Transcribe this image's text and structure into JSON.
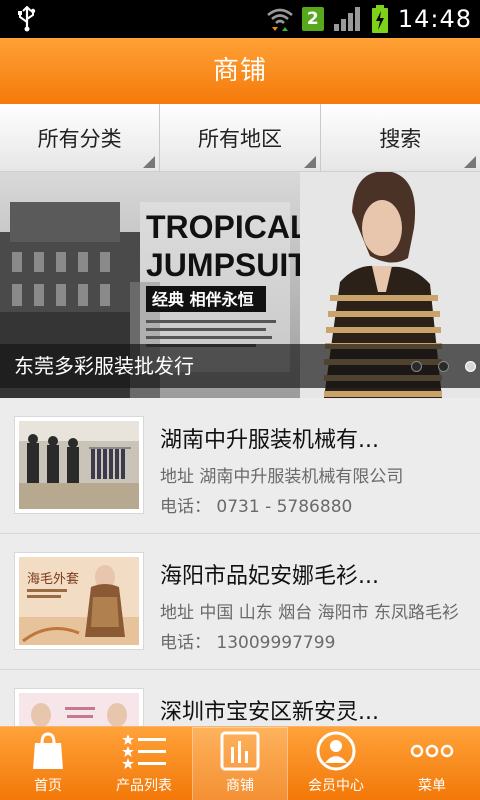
{
  "status_bar": {
    "time": "14:48",
    "notification_count": "2",
    "icons": [
      "usb-icon",
      "wifi-icon",
      "signal-icon",
      "battery-charging-icon"
    ]
  },
  "header": {
    "title": "商铺"
  },
  "filters": [
    {
      "label": "所有分类"
    },
    {
      "label": "所有地区"
    },
    {
      "label": "搜索"
    }
  ],
  "banner": {
    "caption": "东莞多彩服装批发行",
    "headline_line1": "TROPICAL",
    "headline_line2": "JUMPSUIT",
    "tagline": "经典 相伴永恒",
    "slide_count": 3,
    "active_slide": 3
  },
  "shops": [
    {
      "name": "湖南中升服装机械有...",
      "address": "地址  湖南中升服装机械有限公司",
      "phone": "电话：  0731 - 5786880"
    },
    {
      "name": "海阳市品妃安娜毛衫...",
      "address": "地址  中国 山东 烟台 海阳市 东凤路毛衫",
      "phone": "电话：  13009997799",
      "thumb_text": "海毛外套"
    },
    {
      "name": "深圳市宝安区新安灵...",
      "address": "",
      "phone": ""
    }
  ],
  "bottom_nav": [
    {
      "label": "首页",
      "icon": "shopping-bag-icon"
    },
    {
      "label": "产品列表",
      "icon": "star-list-icon"
    },
    {
      "label": "商铺",
      "icon": "shop-bars-icon",
      "active": true
    },
    {
      "label": "会员中心",
      "icon": "user-icon"
    },
    {
      "label": "菜单",
      "icon": "more-dots-icon"
    }
  ],
  "colors": {
    "accent": "#f7860f",
    "status_bar": "#000000",
    "background": "#ececec",
    "badge_green": "#58a81e"
  }
}
